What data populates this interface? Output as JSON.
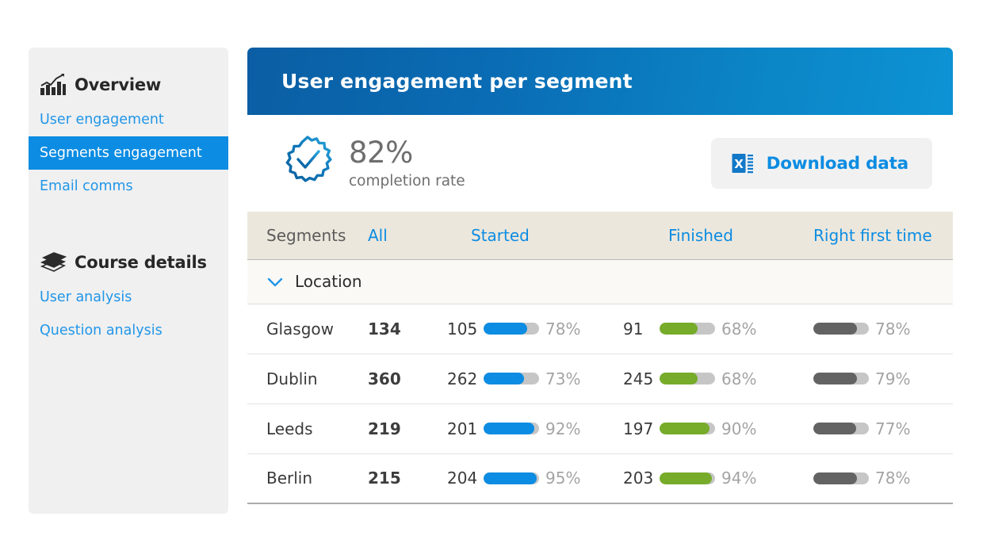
{
  "sidebar": {
    "groups": [
      {
        "icon": "bar-chart-icon",
        "title": "Overview",
        "items": [
          {
            "label": "User engagement",
            "active": false
          },
          {
            "label": "Segments engagement",
            "active": true
          },
          {
            "label": "Email comms",
            "active": false
          }
        ]
      },
      {
        "icon": "stacked-books-icon",
        "title": "Course details",
        "items": [
          {
            "label": "User analysis",
            "active": false
          },
          {
            "label": "Question analysis",
            "active": false
          }
        ]
      }
    ]
  },
  "panel": {
    "header_title": "User engagement per segment",
    "summary": {
      "badge_icon": "check-rosette-icon",
      "rate_value": "82%",
      "rate_label": "completion rate"
    },
    "download_button": {
      "icon": "excel-file-icon",
      "label": "Download data"
    },
    "table": {
      "columns": [
        {
          "key": "segments",
          "label": "Segments",
          "link": false
        },
        {
          "key": "all",
          "label": "All",
          "link": true
        },
        {
          "key": "started",
          "label": "Started",
          "link": true
        },
        {
          "key": "finished",
          "label": "Finished",
          "link": true
        },
        {
          "key": "rft",
          "label": "Right first time",
          "link": true
        }
      ],
      "group": {
        "label": "Location",
        "icon": "chevron-down-icon",
        "expanded": true
      },
      "rows": [
        {
          "segment": "Glasgow",
          "all": "134",
          "started": {
            "count": "105",
            "pct_label": "78%",
            "pct": 78
          },
          "finished": {
            "count": "91",
            "pct_label": "68%",
            "pct": 68
          },
          "right_first_time": {
            "count": "",
            "pct_label": "78%",
            "pct": 78
          }
        },
        {
          "segment": "Dublin",
          "all": "360",
          "started": {
            "count": "262",
            "pct_label": "73%",
            "pct": 73
          },
          "finished": {
            "count": "245",
            "pct_label": "68%",
            "pct": 68
          },
          "right_first_time": {
            "count": "",
            "pct_label": "79%",
            "pct": 79
          }
        },
        {
          "segment": "Leeds",
          "all": "219",
          "started": {
            "count": "201",
            "pct_label": "92%",
            "pct": 92
          },
          "finished": {
            "count": "197",
            "pct_label": "90%",
            "pct": 90
          },
          "right_first_time": {
            "count": "",
            "pct_label": "77%",
            "pct": 77
          }
        },
        {
          "segment": "Berlin",
          "all": "215",
          "started": {
            "count": "204",
            "pct_label": "95%",
            "pct": 95
          },
          "finished": {
            "count": "203",
            "pct_label": "94%",
            "pct": 94
          },
          "right_first_time": {
            "count": "",
            "pct_label": "78%",
            "pct": 78
          }
        }
      ]
    }
  },
  "colors": {
    "accent_blue": "#0c8ce2",
    "header_gradient_start": "#0b5ea3",
    "header_gradient_end": "#0d93d4",
    "bar_started": "#0c8ce2",
    "bar_finished": "#76ac2a",
    "bar_right_first_time": "#636363",
    "bar_track": "#c6c6c6",
    "table_header_bg": "#ece7dc",
    "group_row_bg": "#faf9f5",
    "sidebar_bg": "#f0f0f0"
  },
  "chart_data": {
    "type": "bar",
    "title": "User engagement per segment",
    "categories": [
      "Glasgow",
      "Dublin",
      "Leeds",
      "Berlin"
    ],
    "series": [
      {
        "name": "All",
        "values": [
          134,
          360,
          219,
          215
        ]
      },
      {
        "name": "Started",
        "values": [
          105,
          262,
          201,
          204
        ],
        "pct": [
          78,
          73,
          92,
          95
        ]
      },
      {
        "name": "Finished",
        "values": [
          91,
          245,
          197,
          203
        ],
        "pct": [
          68,
          68,
          90,
          94
        ]
      },
      {
        "name": "Right first time",
        "values": [
          null,
          null,
          null,
          null
        ],
        "pct": [
          78,
          79,
          77,
          78
        ]
      }
    ],
    "xlabel": "Segments",
    "ylabel": "",
    "ylim": [
      0,
      100
    ],
    "grid": false,
    "legend": "none"
  }
}
